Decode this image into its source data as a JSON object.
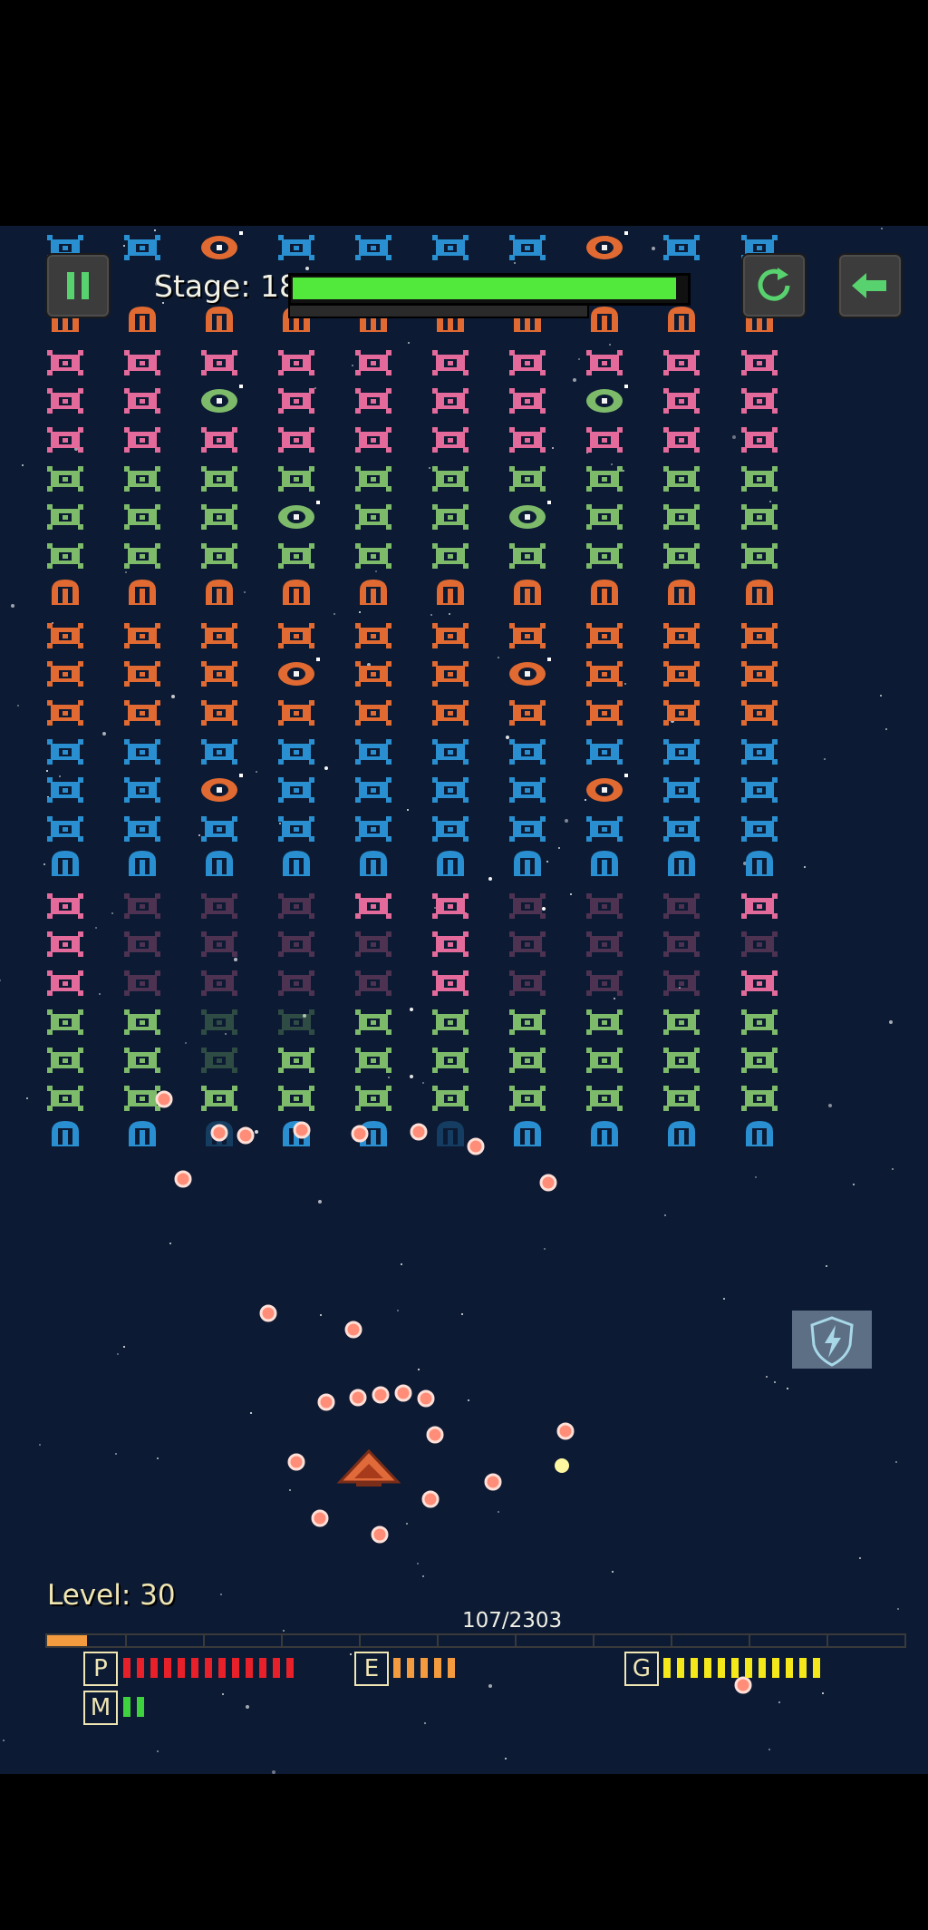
{
  "hud": {
    "stage_label": "Stage: 18",
    "stage_progress": 0.98,
    "level_label": "Level: 30",
    "xp_text": "107/2303",
    "xp_progress": 0.0465
  },
  "stats": [
    {
      "key": "P",
      "pips": 13,
      "color": "#e8202a"
    },
    {
      "key": "E",
      "pips": 5,
      "color": "#f49b3f"
    },
    {
      "key": "G",
      "pips": 12,
      "color": "#f5e81a"
    },
    {
      "key": "M",
      "pips": 2,
      "color": "#3ed23e"
    }
  ],
  "colors": {
    "background": "#0c1a33",
    "pink_alien": "#e36a9a",
    "green_alien": "#7dbb6b",
    "orange_alien": "#e06a32",
    "blue_alien": "#2a8fd0",
    "stage_bar": "#52e83c",
    "player_ship": "#e06a3a",
    "bullet": "#ff8d78"
  },
  "icons": {
    "pause": "pause-icon",
    "restart": "restart-icon",
    "back": "back-arrow-icon",
    "shield_powerup": "shield-lightning-icon",
    "player": "player-ship-icon"
  }
}
